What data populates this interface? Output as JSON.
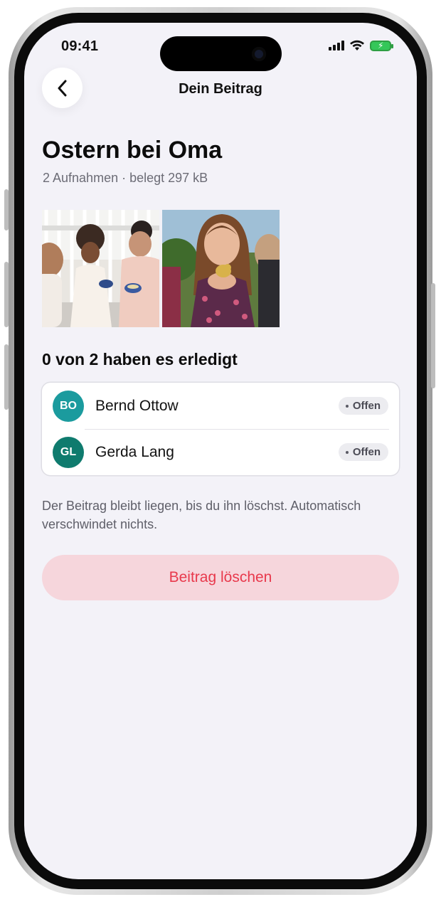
{
  "status_bar": {
    "time": "09:41"
  },
  "nav": {
    "title": "Dein Beitrag",
    "back_icon": "chevron-left-icon"
  },
  "post": {
    "title": "Ostern bei Oma",
    "subtitle": "2 Aufnahmen · belegt 297 kB"
  },
  "progress": {
    "heading": "0 von 2 haben es erledigt",
    "done": 0,
    "total": 2
  },
  "recipients": [
    {
      "initials": "BO",
      "name": "Bernd Ottow",
      "status": "Offen",
      "avatar_color": "#1b9b9e"
    },
    {
      "initials": "GL",
      "name": "Gerda Lang",
      "status": "Offen",
      "avatar_color": "#0f7b6e"
    }
  ],
  "note": "Der Beitrag bleibt liegen, bis du ihn löschst. Automatisch verschwindet nichts.",
  "delete_button": {
    "label": "Beitrag löschen"
  },
  "colors": {
    "accent_red": "#e8394c",
    "delete_bg": "#f6d6dc",
    "screen_bg": "#f3f2f8"
  }
}
